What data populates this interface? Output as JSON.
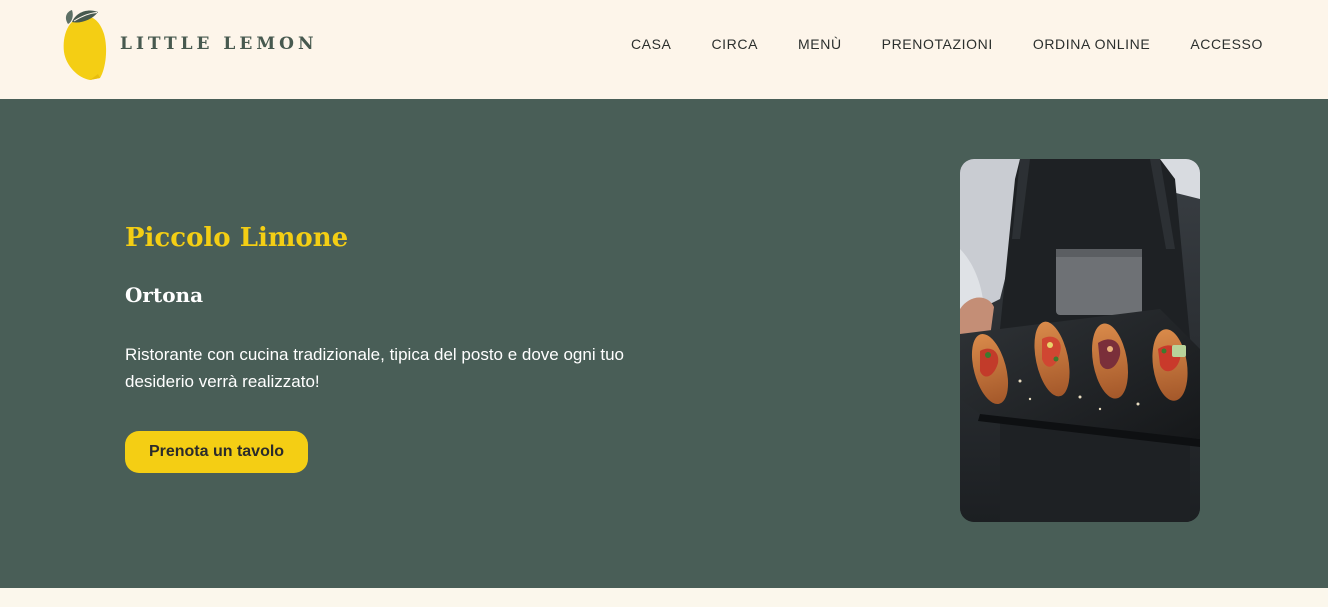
{
  "brand": {
    "name": "LITTLE LEMON",
    "logo_icon": "lemon-icon"
  },
  "nav": {
    "items": [
      {
        "label": "CASA"
      },
      {
        "label": "CIRCA"
      },
      {
        "label": "MENÙ"
      },
      {
        "label": "PRENOTAZIONI"
      },
      {
        "label": "ORDINA ONLINE"
      },
      {
        "label": "ACCESSO"
      }
    ]
  },
  "hero": {
    "title": "Piccolo Limone",
    "subtitle": "Ortona",
    "description": "Ristorante con cucina tradizionale, tipica del posto e dove ogni tuo desiderio verrà realizzato!",
    "cta_label": "Prenota un tavolo",
    "image_subject": "waiter-serving-bruschetta-image"
  },
  "colors": {
    "header_bg": "#fdf5ea",
    "hero_bg": "#495e57",
    "accent_yellow": "#f4ce14",
    "brand_text": "#47594f",
    "page_bg": "#fbf7ec"
  }
}
